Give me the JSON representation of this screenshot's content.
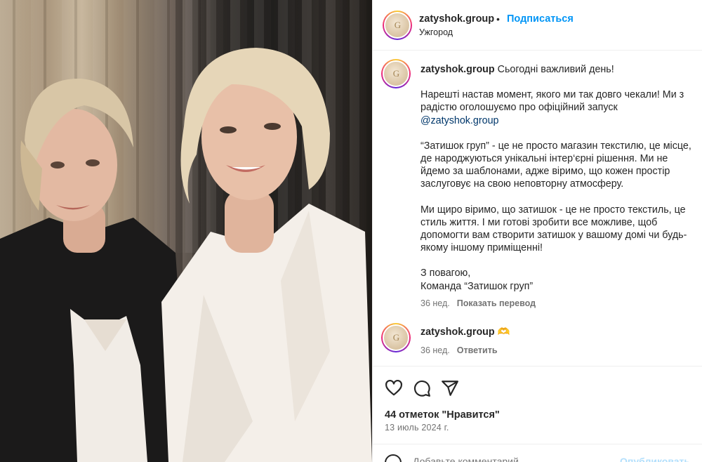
{
  "post": {
    "username": "zatyshok.group",
    "follow_label": "Подписаться",
    "location": "Ужгород",
    "separator": "•"
  },
  "caption": {
    "username": "zatyshok.group",
    "first_line": "Сьогодні важливий день!",
    "paragraph_1": "Нарешті настав момент, якого ми так довго чекали! Ми з радістю оголошуємо про офіційний запуск",
    "mention": "@zatyshok.group",
    "paragraph_2": "“Затишок груп” - це не просто магазин текстилю, це місце, де народжуються унікальні інтер‘єрні рішення. Ми не йдемо за шаблонами, адже віримо, що кожен простір заслуговує на свою неповторну атмосферу.",
    "paragraph_3": "Ми щиро віримо, що затишок - це не просто текстиль, це стиль життя. І ми готові зробити все можливе, щоб допомогти вам створити затишок у вашому домі чи будь-якому іншому приміщенні!",
    "sign_line_1": "З повагою,",
    "sign_line_2": "Команда “Затишок груп”",
    "time": "36 нед.",
    "translate_label": "Показать перевод"
  },
  "comment": {
    "username": "zatyshok.group",
    "emoji": "🫶",
    "time": "36 нед.",
    "reply_label": "Ответить"
  },
  "actions": {
    "like_icon": "heart-icon",
    "comment_icon": "comment-icon",
    "share_icon": "share-icon"
  },
  "likes_text": "44 отметок \"Нравится\"",
  "date_text": "13 июль 2024 г.",
  "add_comment": {
    "placeholder": "Добавьте комментарий...",
    "publish_label": "Опубликовать"
  },
  "avatar": {
    "monogram": "G"
  },
  "colors": {
    "link": "#0095f6",
    "mention": "#00376b",
    "secondary_text": "#737373"
  }
}
